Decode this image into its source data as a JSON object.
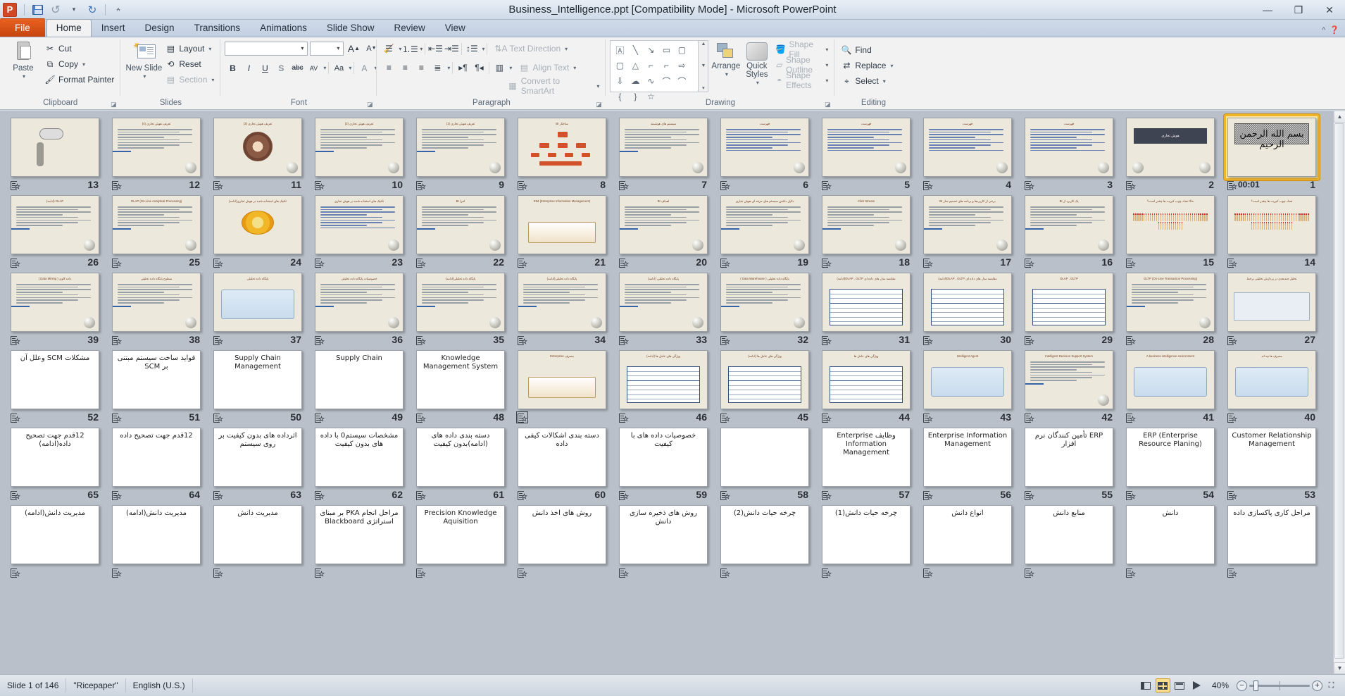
{
  "window": {
    "title": "Business_Intelligence.ppt [Compatibility Mode]  -  Microsoft PowerPoint",
    "app_logo": "powerpoint-logo",
    "minimize": "—",
    "restore": "❐",
    "close": "✕"
  },
  "quick_access": [
    {
      "name": "save",
      "glyph": "save-icon"
    },
    {
      "name": "undo",
      "glyph": "↺"
    },
    {
      "name": "redo",
      "glyph": "↻"
    },
    {
      "name": "customize",
      "glyph": "▾"
    }
  ],
  "tabs": [
    {
      "label": "File",
      "active": false,
      "file": true
    },
    {
      "label": "Home",
      "active": true
    },
    {
      "label": "Insert",
      "active": false
    },
    {
      "label": "Design",
      "active": false
    },
    {
      "label": "Transitions",
      "active": false
    },
    {
      "label": "Animations",
      "active": false
    },
    {
      "label": "Slide Show",
      "active": false
    },
    {
      "label": "Review",
      "active": false
    },
    {
      "label": "View",
      "active": false
    }
  ],
  "ribbon": {
    "groups": [
      {
        "name": "clipboard",
        "label": "Clipboard"
      },
      {
        "name": "slides",
        "label": "Slides"
      },
      {
        "name": "font",
        "label": "Font"
      },
      {
        "name": "paragraph",
        "label": "Paragraph"
      },
      {
        "name": "drawing",
        "label": "Drawing"
      },
      {
        "name": "editing",
        "label": "Editing"
      }
    ],
    "clipboard": {
      "paste": "Paste",
      "cut": "Cut",
      "copy": "Copy",
      "format_painter": "Format Painter"
    },
    "slides": {
      "new_slide": "New Slide",
      "layout": "Layout",
      "reset": "Reset",
      "section": "Section"
    },
    "font": {
      "font_name": "",
      "font_size": "",
      "grow": "A",
      "shrink": "A",
      "clear_formatting": "clear-formatting-icon",
      "bold": "B",
      "italic": "I",
      "underline": "U",
      "shadow": "S",
      "strikethrough": "abc",
      "char_spacing": "AV",
      "change_case": "Aa",
      "font_color": "A"
    },
    "paragraph": {
      "text_direction": "Text Direction",
      "align_text": "Align Text",
      "convert_to_smartart": "Convert to SmartArt"
    },
    "drawing": {
      "arrange": "Arrange",
      "quick_styles": "Quick Styles",
      "shape_fill": "Shape Fill",
      "shape_outline": "Shape Outline",
      "shape_effects": "Shape Effects"
    },
    "editing": {
      "find": "Find",
      "replace": "Replace",
      "select": "Select"
    }
  },
  "status_bar": {
    "slide_indicator": "Slide 1 of 146",
    "theme": "\"Ricepaper\"",
    "language": "English (U.S.)",
    "zoom_level": "40%",
    "zoom_minus": "−",
    "zoom_plus": "+",
    "views": [
      {
        "name": "normal-view",
        "active": false
      },
      {
        "name": "slide-sorter-view",
        "active": true
      },
      {
        "name": "reading-view",
        "active": false
      },
      {
        "name": "slide-show-view",
        "active": false
      }
    ],
    "fit_to_window": "fit-slide-icon"
  },
  "slides": [
    {
      "num": "13",
      "kind": "figure-thinker",
      "title": "",
      "selected": false
    },
    {
      "num": "12",
      "kind": "bullets",
      "title": "تعریف هوش تجاری (4)",
      "selected": false
    },
    {
      "num": "11",
      "kind": "donut",
      "title": "تعریف هوش تجاری (3)",
      "selected": false
    },
    {
      "num": "10",
      "kind": "bullets",
      "title": "تعریف هوش تجاری (2)",
      "selected": false
    },
    {
      "num": "9",
      "kind": "bullets",
      "title": "تعریف هوش تجاری (1)",
      "selected": false
    },
    {
      "num": "8",
      "kind": "tree",
      "title": "ساختار BI",
      "selected": false
    },
    {
      "num": "7",
      "kind": "bullets",
      "title": "سیستم های هوشمند",
      "selected": false
    },
    {
      "num": "6",
      "kind": "toc",
      "title": "فهرست",
      "selected": false
    },
    {
      "num": "5",
      "kind": "toc",
      "title": "فهرست",
      "selected": false
    },
    {
      "num": "4",
      "kind": "toc",
      "title": "فهرست",
      "selected": false
    },
    {
      "num": "3",
      "kind": "toc-graph",
      "title": "فهرست",
      "selected": false
    },
    {
      "num": "2",
      "kind": "darkbanner",
      "title": "هوش تجاری",
      "selected": false
    },
    {
      "num": "1",
      "kind": "bismillah",
      "title": "بسم الله الرحمن الرحیم",
      "time": "00:01",
      "selected": true
    },
    {
      "num": "26",
      "kind": "bullets",
      "title": "OLAP (ادامه)",
      "selected": false
    },
    {
      "num": "25",
      "kind": "bullets",
      "title": "OLAP (On-Line Analytical Processing)",
      "selected": false
    },
    {
      "num": "24",
      "kind": "enterprise",
      "title": "تکنیک های استفاده شده در هوش تجاری(ادامه)",
      "selected": false
    },
    {
      "num": "23",
      "kind": "bullets-links",
      "title": "تکنیک های استفاده شده در هوش تجاری",
      "selected": false
    },
    {
      "num": "22",
      "kind": "bullets",
      "title": "اجزا BI",
      "selected": false
    },
    {
      "num": "21",
      "kind": "book",
      "title": "(Enterprise Information Management) EIM",
      "selected": false
    },
    {
      "num": "20",
      "kind": "bullets",
      "title": "اهداف BI",
      "selected": false
    },
    {
      "num": "19",
      "kind": "bullets",
      "title": "دلایل داشتن سیستم های حرفه ای هوش تجاری",
      "selected": false
    },
    {
      "num": "18",
      "kind": "bullets",
      "title": "Click Stream",
      "selected": false
    },
    {
      "num": "17",
      "kind": "bullets",
      "title": "برخی از کاربردها و برنامه های تصمیم ساز BI",
      "selected": false
    },
    {
      "num": "16",
      "kind": "bullets",
      "title": "یک کاربرد از BI",
      "selected": false
    },
    {
      "num": "15",
      "kind": "matches",
      "title": "حالا تعداد چوب کبریت ها چقدر است؟",
      "selected": false
    },
    {
      "num": "14",
      "kind": "matches-scatter",
      "title": "تعداد چوب کبریت ها چقدر است؟",
      "selected": false
    },
    {
      "num": "39",
      "kind": "bullets",
      "title": "داده کاوی ( Data Mining )",
      "selected": false
    },
    {
      "num": "38",
      "kind": "bullets",
      "title": "سطوح پایگاه داده تحلیلی",
      "selected": false
    },
    {
      "num": "37",
      "kind": "diagram",
      "title": "پایگاه داده تحلیلی",
      "selected": false
    },
    {
      "num": "36",
      "kind": "bullets",
      "title": "خصوصیات پایگاه داده تحلیلی",
      "selected": false
    },
    {
      "num": "35",
      "kind": "bullets",
      "title": "پایگاه داده تحلیلی(ادامه)",
      "selected": false
    },
    {
      "num": "34",
      "kind": "bullets",
      "title": "پایگاه داده تحلیلی(ادامه)",
      "selected": false
    },
    {
      "num": "33",
      "kind": "bullets",
      "title": "پایگاه داده تحلیلی (ادامه)",
      "selected": false
    },
    {
      "num": "32",
      "kind": "bullets",
      "title": "پایگاه داده تحلیلی ( Data Warehouse )",
      "selected": false
    },
    {
      "num": "31",
      "kind": "table",
      "title": "مقایسه مدل های داده ای OLAP , OLTP(ادامه)",
      "selected": false
    },
    {
      "num": "30",
      "kind": "table",
      "title": "مقایسه مدل های داده ای OLAP , OLTP(ادامه)",
      "selected": false
    },
    {
      "num": "29",
      "kind": "table",
      "title": "OLAP , OLTP",
      "selected": false
    },
    {
      "num": "28",
      "kind": "bullets",
      "title": "OLTP (On-Line Transaction Processing)",
      "selected": false
    },
    {
      "num": "27",
      "kind": "screens",
      "title": "تحلیل چندبعدی در پردازش تحلیلی برخط",
      "selected": false
    },
    {
      "num": "52",
      "kind": "bigtext-rtl",
      "title": "مشکلات SCM وعلل آن",
      "selected": false
    },
    {
      "num": "51",
      "kind": "bigtext-rtl",
      "title": "فواید ساخت سیستم مبتنی بر SCM",
      "selected": false
    },
    {
      "num": "50",
      "kind": "bigtext",
      "title": "Supply Chain Management",
      "selected": false
    },
    {
      "num": "49",
      "kind": "bigtext",
      "title": "Supply Chain",
      "selected": false
    },
    {
      "num": "48",
      "kind": "bigtext",
      "title": "Knowledge Management System",
      "selected": false
    },
    {
      "num": "",
      "kind": "book-enterprise",
      "title": "مصرف Enterprise",
      "transition_selected": true,
      "selected": false
    },
    {
      "num": "46",
      "kind": "table",
      "title": "ویژگی های عامل ها (ادامه)",
      "selected": false
    },
    {
      "num": "45",
      "kind": "table",
      "title": "ویژگی های عامل ها (ادامه)",
      "selected": false
    },
    {
      "num": "44",
      "kind": "table",
      "title": "ویژگی های عامل ها",
      "selected": false
    },
    {
      "num": "43",
      "kind": "agent-diagram",
      "title": "Intelligent Agent",
      "selected": false
    },
    {
      "num": "42",
      "kind": "bullets",
      "title": "Intelligent Decision Support System",
      "selected": false
    },
    {
      "num": "41",
      "kind": "network",
      "title": "A business intelligence environment",
      "selected": false
    },
    {
      "num": "40",
      "kind": "diagram2",
      "title": "مصرف ها چه اند",
      "selected": false
    },
    {
      "num": "65",
      "kind": "bigtext-rtl",
      "title": "12قدم جهت تصحیح داده(ادامه)",
      "selected": false
    },
    {
      "num": "64",
      "kind": "bigtext-rtl",
      "title": "12قدم جهت تصحیح داده",
      "selected": false
    },
    {
      "num": "63",
      "kind": "bigtext-rtl",
      "title": "اثرداده های بدون کیفیت بر روی سیستم",
      "selected": false
    },
    {
      "num": "62",
      "kind": "bigtext-rtl",
      "title": "مشخصات سیستم0 با داده های بدون کیفیت",
      "selected": false
    },
    {
      "num": "61",
      "kind": "bigtext-rtl",
      "title": "دسته بندی داده های (ادامه)بدون کیفیت",
      "selected": false
    },
    {
      "num": "60",
      "kind": "bigtext-rtl",
      "title": "دسته بندی اشکالات کیفی داده",
      "selected": false
    },
    {
      "num": "59",
      "kind": "bigtext-rtl",
      "title": "خصوصیات داده های با کیفیت",
      "selected": false
    },
    {
      "num": "58",
      "kind": "blank",
      "title": "",
      "selected": false
    },
    {
      "num": "57",
      "kind": "bigtext-rtl",
      "title": "وظایف Enterprise Information Management",
      "selected": false
    },
    {
      "num": "56",
      "kind": "bigtext",
      "title": "Enterprise Information Management",
      "selected": false
    },
    {
      "num": "55",
      "kind": "bigtext-rtl",
      "title": "ERP تأمین کنندگان نرم افزار",
      "selected": false
    },
    {
      "num": "54",
      "kind": "bigtext",
      "title": "ERP (Enterprise Resource Planing)",
      "selected": false
    },
    {
      "num": "53",
      "kind": "bigtext",
      "title": "Customer Relationship Management",
      "selected": false
    },
    {
      "num": "",
      "kind": "bigtext-rtl",
      "title": "مدیریت دانش(ادامه)",
      "selected": false
    },
    {
      "num": "",
      "kind": "bigtext-rtl",
      "title": "مدیریت دانش(ادامه)",
      "selected": false
    },
    {
      "num": "",
      "kind": "bigtext-rtl",
      "title": "مدیریت دانش",
      "selected": false
    },
    {
      "num": "",
      "kind": "bigtext-rtl",
      "title": "مراحل انجام PKA بر مبنای استراتژی Blackboard",
      "selected": false
    },
    {
      "num": "",
      "kind": "bigtext",
      "title": "Precision Knowledge Aquisition",
      "selected": false
    },
    {
      "num": "",
      "kind": "bigtext-rtl",
      "title": "روش های اخذ دانش",
      "selected": false
    },
    {
      "num": "",
      "kind": "bigtext-rtl",
      "title": "روش های ذخیره سازی دانش",
      "selected": false
    },
    {
      "num": "",
      "kind": "bigtext-rtl",
      "title": "چرخه حیات دانش(2)",
      "selected": false
    },
    {
      "num": "",
      "kind": "bigtext-rtl",
      "title": "چرخه حیات دانش(1)",
      "selected": false
    },
    {
      "num": "",
      "kind": "bigtext-rtl",
      "title": "انواع دانش",
      "selected": false
    },
    {
      "num": "",
      "kind": "bigtext-rtl",
      "title": "منابع دانش",
      "selected": false
    },
    {
      "num": "",
      "kind": "bigtext-rtl",
      "title": "دانش",
      "selected": false
    },
    {
      "num": "",
      "kind": "bigtext-rtl",
      "title": "مراحل کاری پاکسازی داده",
      "selected": false
    }
  ]
}
